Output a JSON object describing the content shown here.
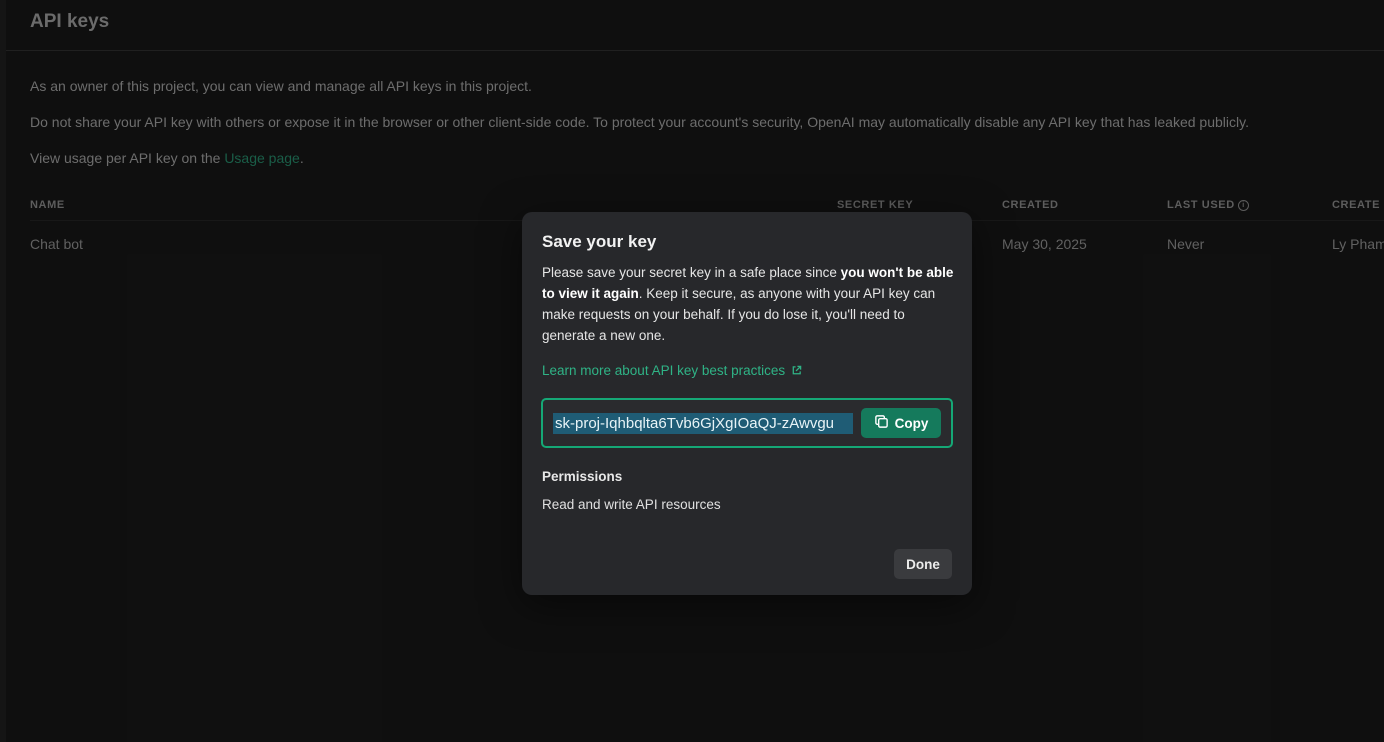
{
  "page": {
    "title": "API keys",
    "desc_owner": "As an owner of this project, you can view and manage all API keys in this project.",
    "desc_security": "Do not share your API key with others or expose it in the browser or other client-side code. To protect your account's security, OpenAI may automatically disable any API key that has leaked publicly.",
    "desc_usage_prefix": "View usage per API key on the ",
    "desc_usage_link": "Usage page",
    "desc_usage_suffix": "."
  },
  "table": {
    "columns": {
      "name": "NAME",
      "secret_key": "SECRET KEY",
      "created": "CREATED",
      "last_used": "LAST USED",
      "created_by": "CREATE"
    },
    "rows": [
      {
        "name": "Chat bot",
        "created": "May 30, 2025",
        "last_used": "Never",
        "created_by": "Ly Pham"
      }
    ]
  },
  "modal": {
    "title": "Save your key",
    "body_part1": "Please save your secret key in a safe place since ",
    "body_bold": "you won't be able to view it again",
    "body_part2": ". Keep it secure, as anyone with your API key can make requests on your behalf. If you do lose it, you'll need to generate a new one.",
    "learn_more": "Learn more about API key best practices",
    "secret_key": "sk-proj-Iqhbqlta6Tvb6GjXgIOaQJ-zAwvgu",
    "copy_label": "Copy",
    "permissions_title": "Permissions",
    "permissions_value": "Read and write API resources",
    "done_label": "Done"
  },
  "colors": {
    "accent": "#15a876",
    "copy_button": "#157a5c",
    "selection": "#1f5c75"
  },
  "icons": {
    "learn_more": "external-link-icon",
    "copy": "copy-icon",
    "last_used_info": "info-icon"
  }
}
